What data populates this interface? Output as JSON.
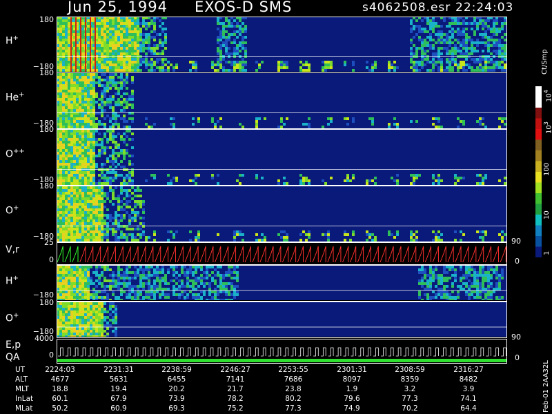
{
  "header": {
    "date": "Jun 25, 1994",
    "mission": "EXOS-D SMS",
    "file": "s4062508.esr",
    "time": "22:24:03"
  },
  "panels": [
    {
      "label_main": "H",
      "label_sup": "+",
      "tick_top": "180",
      "tick_bottom": "−180"
    },
    {
      "label_main": "He",
      "label_sup": "+",
      "tick_top": "180",
      "tick_bottom": "−180"
    },
    {
      "label_main": "O",
      "label_sup": "++",
      "tick_top": "180",
      "tick_bottom": "−180"
    },
    {
      "label_main": "O",
      "label_sup": "+",
      "tick_top": "180",
      "tick_bottom": "−180"
    },
    {
      "label_main": "V,r",
      "label_sup": "",
      "tick_top": "25",
      "tick_bottom": "0"
    },
    {
      "label_main": "H",
      "label_sup": "+",
      "tick_top": "",
      "tick_bottom": "−180"
    },
    {
      "label_main": "O",
      "label_sup": "+",
      "tick_top": "180",
      "tick_bottom": "−180"
    },
    {
      "label_main": "E,p",
      "label_sup": "",
      "tick_top": "4000",
      "tick_bottom": "0"
    }
  ],
  "qa_label": "QA",
  "right_axis": {
    "vr_top": "90",
    "vr_bottom": "0",
    "ep_top": "90",
    "ep_bottom": "0"
  },
  "colorbar": {
    "unit": "Ct/Smp",
    "labels": [
      "10",
      "4",
      "10",
      "3",
      "100",
      "10",
      "1"
    ]
  },
  "footer_vertical": "Feb-01 2AA32L",
  "table": {
    "rows": [
      {
        "name": "UT",
        "values": [
          "2224:03",
          "2231:31",
          "2238:59",
          "2246:27",
          "2253:55",
          "2301:31",
          "2308:59",
          "2316:27"
        ]
      },
      {
        "name": "ALT",
        "values": [
          "4677",
          "5631",
          "6455",
          "7141",
          "7686",
          "8097",
          "8359",
          "8482"
        ]
      },
      {
        "name": "MLT",
        "values": [
          "18.8",
          "19.4",
          "20.2",
          "21.7",
          "23.8",
          "1.9",
          "3.2",
          "3.9"
        ]
      },
      {
        "name": "InLat",
        "values": [
          "60.1",
          "67.9",
          "73.9",
          "78.2",
          "80.2",
          "79.6",
          "77.3",
          "74.1"
        ]
      },
      {
        "name": "MLat",
        "values": [
          "50.2",
          "60.9",
          "69.3",
          "75.2",
          "77.3",
          "74.9",
          "70.2",
          "64.4"
        ]
      }
    ]
  },
  "colors": {
    "background": "#000000",
    "spectrogram_bg": "#0a1a7a",
    "vr_line_red": "#ff3030",
    "vr_line_green": "#30ff30",
    "qa_green": "#30e030"
  }
}
